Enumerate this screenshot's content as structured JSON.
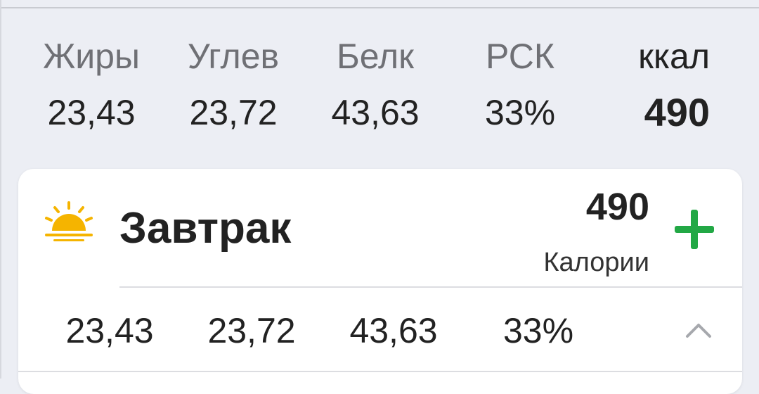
{
  "summary": {
    "columns": [
      {
        "label": "Жиры",
        "value": "23,43"
      },
      {
        "label": "Углев",
        "value": "23,72"
      },
      {
        "label": "Белк",
        "value": "43,63"
      },
      {
        "label": "РСК",
        "value": "33%"
      },
      {
        "label": "ккал",
        "value": "490"
      }
    ]
  },
  "meal": {
    "title": "Завтрак",
    "icon": "sunrise-icon",
    "calories": "490",
    "calories_label": "Калории",
    "add_icon": "plus-icon",
    "expand_icon": "chevron-up-icon",
    "values": [
      "23,43",
      "23,72",
      "43,63",
      "33%"
    ]
  },
  "colors": {
    "accent_green": "#22a845",
    "sun_yellow": "#f5b400",
    "background": "#eceef4"
  }
}
